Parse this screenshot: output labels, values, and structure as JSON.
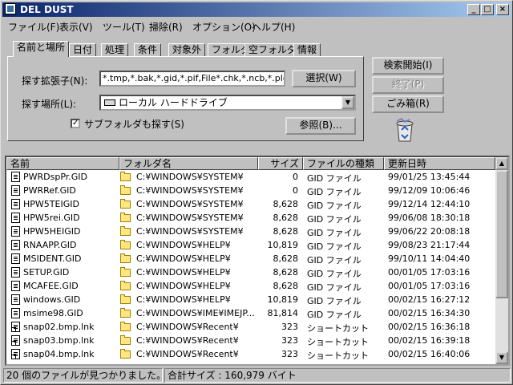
{
  "window": {
    "title": "DEL DUST",
    "minimize": "_",
    "maximize": "□",
    "close": "×"
  },
  "menu": [
    "ファイル(F)",
    "表示(V)",
    "ツール(T)",
    "掃除(R)",
    "オプション(O)",
    "ヘルプ(H)"
  ],
  "tabs": [
    "名前と場所",
    "日付",
    "処理",
    "条件",
    "対象外",
    "フォルダ",
    "空フォルダ",
    "情報"
  ],
  "search": {
    "ext_label": "探す拡張子(N):",
    "ext_value": "*.tmp,*.bak,*.gid,*.pif,File*.chk,*.ncb,*.plg,*.o",
    "select_button": "選択(W)",
    "location_label": "探す場所(L):",
    "location_value": "ローカル ハードドライブ",
    "subfolder_label": "サブフォルダも探す(S)",
    "subfolder_checked": "✓",
    "browse_button": "参照(B)..."
  },
  "actions": {
    "start": "検索開始(I)",
    "stop": "終了(P)",
    "trash": "ごみ箱(R)"
  },
  "columns": [
    "名前",
    "フォルダ名",
    "サイズ",
    "ファイルの種類",
    "更新日時"
  ],
  "files": [
    {
      "name": "PWRDspPr.GID",
      "folder": "C:¥WINDOWS¥SYSTEM¥",
      "size": "0",
      "type": "GID ファイル",
      "date": "99/01/25 13:45:44",
      "lnk": false
    },
    {
      "name": "PWRRef.GID",
      "folder": "C:¥WINDOWS¥SYSTEM¥",
      "size": "0",
      "type": "GID ファイル",
      "date": "99/12/09 10:06:46",
      "lnk": false
    },
    {
      "name": "HPW5TEIGID",
      "folder": "C:¥WINDOWS¥SYSTEM¥",
      "size": "8,628",
      "type": "GID ファイル",
      "date": "99/12/14 12:44:10",
      "lnk": false
    },
    {
      "name": "HPW5rei.GID",
      "folder": "C:¥WINDOWS¥SYSTEM¥",
      "size": "8,628",
      "type": "GID ファイル",
      "date": "99/06/08 18:30:18",
      "lnk": false
    },
    {
      "name": "HPW5HEIGID",
      "folder": "C:¥WINDOWS¥SYSTEM¥",
      "size": "8,628",
      "type": "GID ファイル",
      "date": "99/06/22 20:08:18",
      "lnk": false
    },
    {
      "name": "RNAAPP.GID",
      "folder": "C:¥WINDOWS¥HELP¥",
      "size": "10,819",
      "type": "GID ファイル",
      "date": "99/08/23 21:17:44",
      "lnk": false
    },
    {
      "name": "MSIDENT.GID",
      "folder": "C:¥WINDOWS¥HELP¥",
      "size": "8,628",
      "type": "GID ファイル",
      "date": "99/10/11 14:04:40",
      "lnk": false
    },
    {
      "name": "SETUP.GID",
      "folder": "C:¥WINDOWS¥HELP¥",
      "size": "8,628",
      "type": "GID ファイル",
      "date": "00/01/05 17:03:16",
      "lnk": false
    },
    {
      "name": "MCAFEE.GID",
      "folder": "C:¥WINDOWS¥HELP¥",
      "size": "8,628",
      "type": "GID ファイル",
      "date": "00/01/05 17:03:16",
      "lnk": false
    },
    {
      "name": "windows.GID",
      "folder": "C:¥WINDOWS¥HELP¥",
      "size": "10,819",
      "type": "GID ファイル",
      "date": "00/02/15 16:27:12",
      "lnk": false
    },
    {
      "name": "msime98.GID",
      "folder": "C:¥WINDOWS¥IME¥IMEJP...",
      "size": "81,814",
      "type": "GID ファイル",
      "date": "00/02/15 16:34:30",
      "lnk": false
    },
    {
      "name": "snap02.bmp.lnk",
      "folder": "C:¥WINDOWS¥Recent¥",
      "size": "323",
      "type": "ショートカット",
      "date": "00/02/15 16:36:18",
      "lnk": true
    },
    {
      "name": "snap03.bmp.lnk",
      "folder": "C:¥WINDOWS¥Recent¥",
      "size": "323",
      "type": "ショートカット",
      "date": "00/02/15 16:39:18",
      "lnk": true
    },
    {
      "name": "snap04.bmp.lnk",
      "folder": "C:¥WINDOWS¥Recent¥",
      "size": "323",
      "type": "ショートカット",
      "date": "00/02/15 16:40:06",
      "lnk": true
    }
  ],
  "status": {
    "count": "20 個のファイルが見つかりました。",
    "total": "合計サイズ : 160,979 バイト"
  },
  "colors": {
    "title_start": "#0a246a",
    "title_end": "#a6caf0",
    "face": "#c0c0c0",
    "folder": "#ffe680"
  }
}
